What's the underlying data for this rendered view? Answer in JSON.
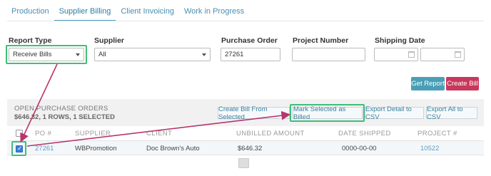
{
  "tabs": [
    {
      "label": "Production",
      "active": false
    },
    {
      "label": "Supplier Billing",
      "active": true
    },
    {
      "label": "Client Invoicing",
      "active": false
    },
    {
      "label": "Work in Progress",
      "active": false
    }
  ],
  "filters": {
    "report_type": {
      "label": "Report Type",
      "value": "Receive Bills"
    },
    "supplier": {
      "label": "Supplier",
      "value": "All"
    },
    "purchase_order": {
      "label": "Purchase Order",
      "value": "27261"
    },
    "project_number": {
      "label": "Project Number",
      "value": ""
    },
    "shipping_date": {
      "label": "Shipping Date",
      "from": "",
      "to": ""
    }
  },
  "actions": {
    "get_report": "Get Report",
    "create_bill": "Create Bill"
  },
  "orders": {
    "title": "OPEN PURCHASE ORDERS",
    "summary": "$646.32, 1 ROWS, 1 SELECTED",
    "buttons": {
      "create_bill_from_selected": "Create Bill From Selected",
      "mark_selected_billed": "Mark Selected as Billed",
      "export_detail_csv": "Export Detail to CSV",
      "export_all_csv": "Export All to CSV"
    },
    "columns": [
      "PO #",
      "SUPPLIER",
      "CLIENT",
      "UNBILLED AMOUNT",
      "DATE SHIPPED",
      "PROJECT #"
    ],
    "rows": [
      {
        "checked": true,
        "po": "27261",
        "supplier": "WBPromotion",
        "client": "Doc Brown's Auto",
        "unbilled": "$646.32",
        "date_shipped": "0000-00-00",
        "project": "10522"
      }
    ]
  },
  "colors": {
    "accent": "#4a9fb8",
    "danger": "#c8385a",
    "highlight": "#3fbf78",
    "arrow": "#b8356e"
  }
}
